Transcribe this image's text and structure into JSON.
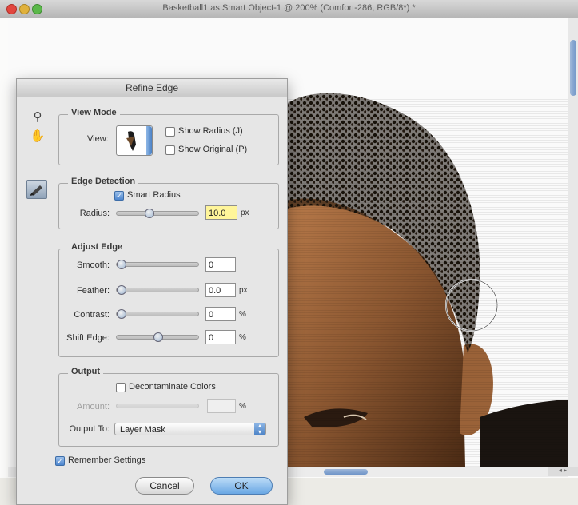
{
  "window": {
    "title": "Basketball1 as Smart Object-1 @ 200% (Comfort-286, RGB/8*) *",
    "scroll_corner_label": "◂ ▸"
  },
  "dialog": {
    "title": "Refine Edge",
    "tools": [
      {
        "icon": "zoom-tool-icon"
      },
      {
        "icon": "hand-tool-icon"
      },
      {
        "icon": "refine-radius-brush-icon"
      }
    ],
    "view_mode": {
      "heading": "View Mode",
      "view_label": "View:",
      "show_radius": {
        "label": "Show Radius (J)",
        "checked": false
      },
      "show_original": {
        "label": "Show Original (P)",
        "checked": false
      }
    },
    "edge_detection": {
      "heading": "Edge Detection",
      "smart_radius": {
        "label": "Smart Radius",
        "checked": true
      },
      "radius": {
        "label": "Radius:",
        "value": "10.0",
        "unit": "px",
        "slider_fraction": 0.38
      }
    },
    "adjust_edge": {
      "heading": "Adjust Edge",
      "smooth": {
        "label": "Smooth:",
        "value": "0",
        "unit": "",
        "slider_fraction": 0.0
      },
      "feather": {
        "label": "Feather:",
        "value": "0.0",
        "unit": "px",
        "slider_fraction": 0.0
      },
      "contrast": {
        "label": "Contrast:",
        "value": "0",
        "unit": "%",
        "slider_fraction": 0.0
      },
      "shift_edge": {
        "label": "Shift Edge:",
        "value": "0",
        "unit": "%",
        "slider_fraction": 0.5
      }
    },
    "output": {
      "heading": "Output",
      "decontaminate": {
        "label": "Decontaminate Colors",
        "checked": false
      },
      "amount": {
        "label": "Amount:",
        "value": "",
        "unit": "%"
      },
      "output_to": {
        "label": "Output To:",
        "selected": "Layer Mask"
      }
    },
    "remember_settings": {
      "label": "Remember Settings",
      "checked": true
    },
    "cancel_label": "Cancel",
    "ok_label": "OK"
  },
  "colors": {
    "accent": "#4d86cf",
    "highlight_field": "#fff59a",
    "close_light": "#e2463f",
    "min_light": "#e0b13c",
    "zoom_light": "#5bb84a"
  }
}
